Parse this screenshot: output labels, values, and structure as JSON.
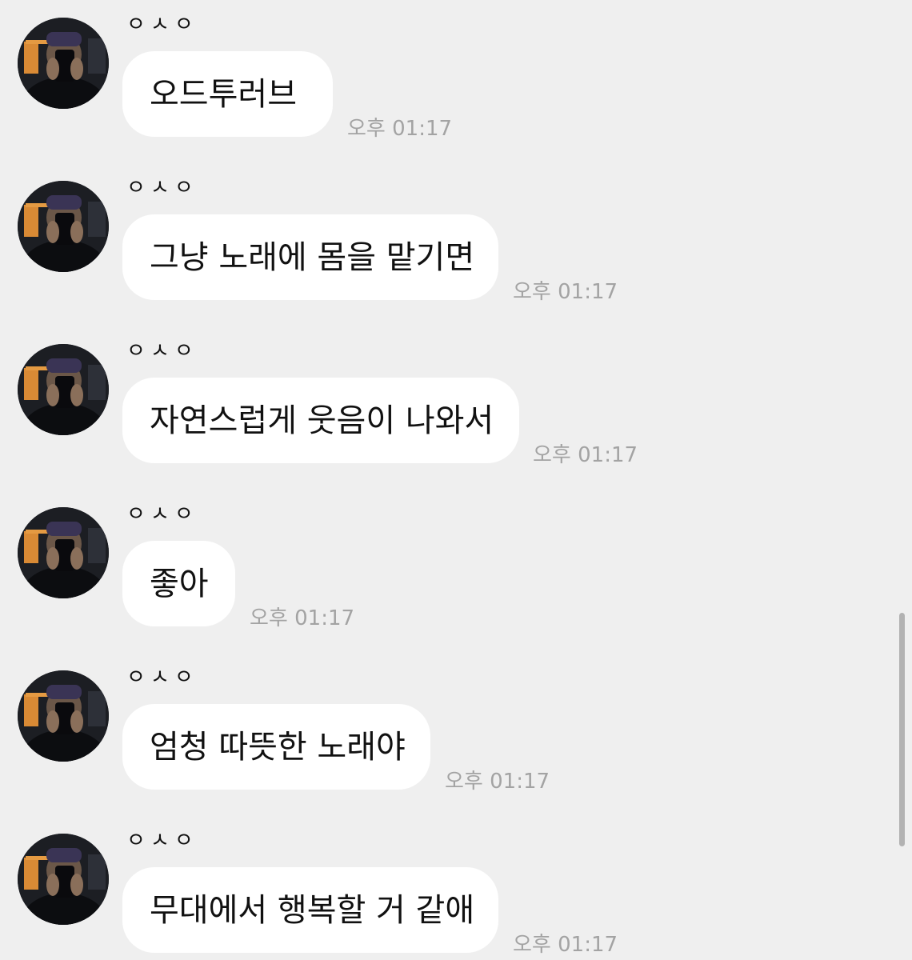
{
  "messages": [
    {
      "sender": "ㅇㅅㅇ",
      "text": "오드투러브",
      "time": "오후 01:17"
    },
    {
      "sender": "ㅇㅅㅇ",
      "text": "그냥 노래에 몸을 맡기면",
      "time": "오후 01:17"
    },
    {
      "sender": "ㅇㅅㅇ",
      "text": "자연스럽게 웃음이 나와서",
      "time": "오후 01:17"
    },
    {
      "sender": "ㅇㅅㅇ",
      "text": "좋아",
      "time": "오후 01:17"
    },
    {
      "sender": "ㅇㅅㅇ",
      "text": "엄청 따뜻한 노래야",
      "time": "오후 01:17"
    },
    {
      "sender": "ㅇㅅㅇ",
      "text": "무대에서 행복할 거 같애",
      "time": "오후 01:17"
    }
  ],
  "colors": {
    "background": "#efefef",
    "bubble": "#ffffff",
    "time_text": "#a3a3a3",
    "scrollbar": "#b2b2b2"
  },
  "icons": {
    "avatar": "profile-photo"
  }
}
